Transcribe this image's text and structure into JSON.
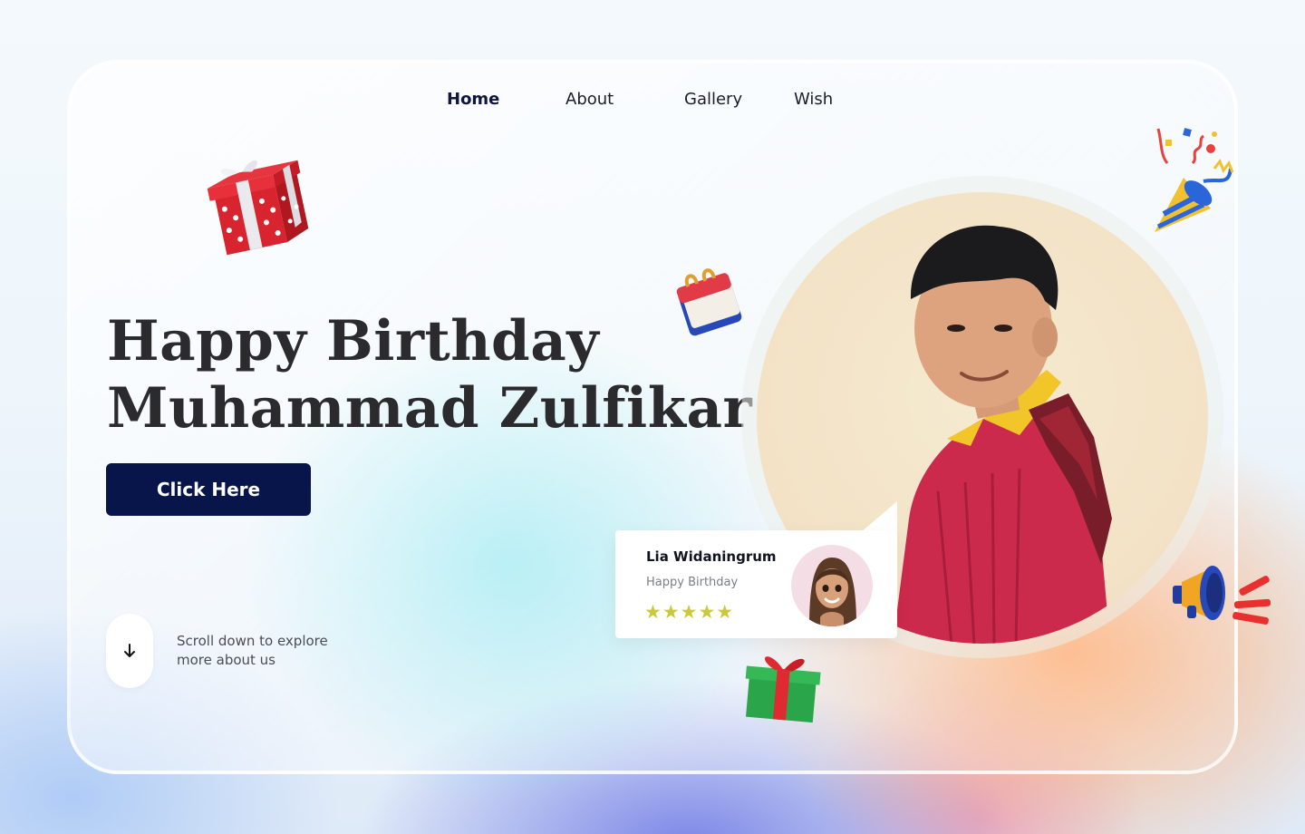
{
  "nav": {
    "items": [
      {
        "label": "Home",
        "active": true
      },
      {
        "label": "About",
        "active": false
      },
      {
        "label": "Gallery",
        "active": false
      },
      {
        "label": "Wish",
        "active": false
      }
    ]
  },
  "hero": {
    "title_line1": "Happy Birthday",
    "title_line2": "Muhammad Zulfikar",
    "cta_label": "Click Here"
  },
  "scroll": {
    "icon": "arrow-down-icon",
    "text_line1": "Scroll down to explore",
    "text_line2": "more about us"
  },
  "review": {
    "name": "Lia Widaningrum",
    "message": "Happy Birthday",
    "stars": "★★★★★",
    "rating": 5,
    "star_color": "#c9c93b"
  },
  "colors": {
    "primary": "#07154a",
    "title": "#2b2b2e",
    "nav_active": "#0d1540"
  },
  "decorations": [
    "gift-box-red-icon",
    "calendar-icon",
    "party-popper-icon",
    "megaphone-icon",
    "gift-box-green-icon"
  ]
}
